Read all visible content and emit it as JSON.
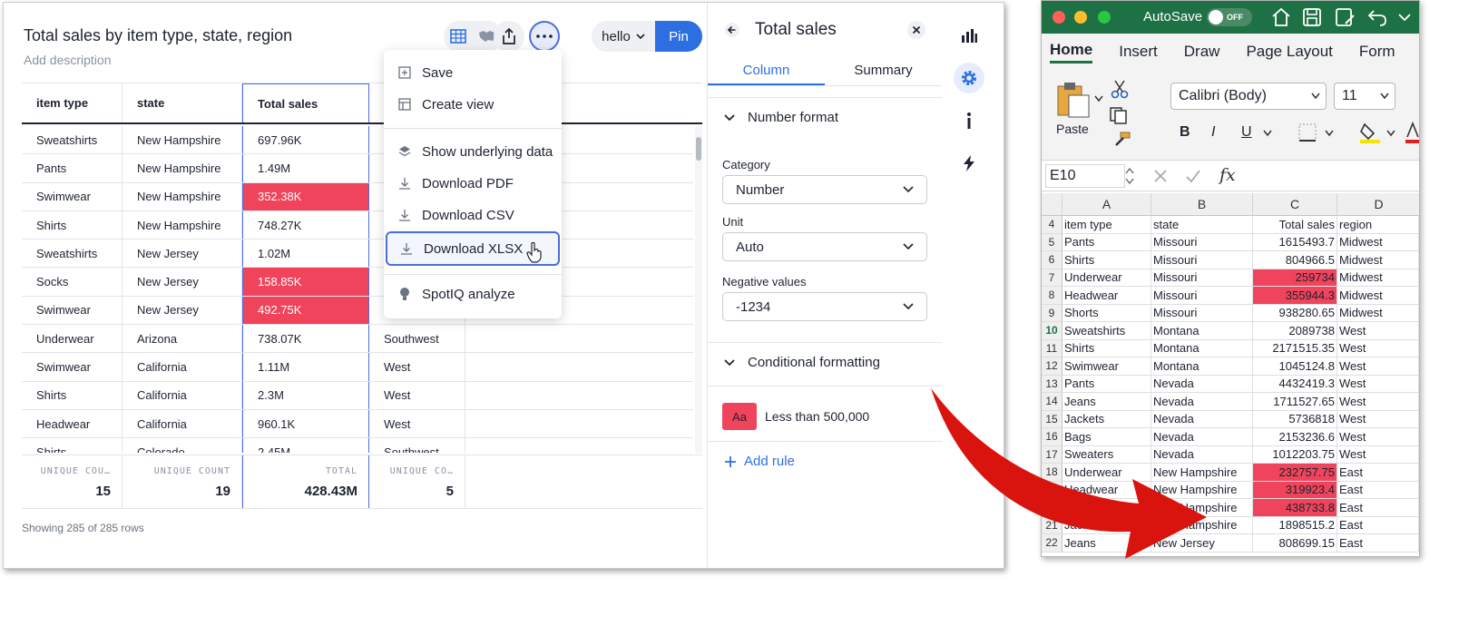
{
  "liveboard": {
    "title": "Total sales by item type, state, region",
    "description": "Add description",
    "hello_label": "hello",
    "pin_label": "Pin",
    "columns": [
      "item type",
      "state",
      "Total sales",
      "region"
    ],
    "rows": [
      {
        "item": "Sweatshirts",
        "state": "New Hampshire",
        "sales": "697.96K",
        "region": "",
        "hl": false
      },
      {
        "item": "Pants",
        "state": "New Hampshire",
        "sales": "1.49M",
        "region": "",
        "hl": false
      },
      {
        "item": "Swimwear",
        "state": "New Hampshire",
        "sales": "352.38K",
        "region": "",
        "hl": true
      },
      {
        "item": "Shirts",
        "state": "New Hampshire",
        "sales": "748.27K",
        "region": "",
        "hl": false
      },
      {
        "item": "Sweatshirts",
        "state": "New Jersey",
        "sales": "1.02M",
        "region": "",
        "hl": false
      },
      {
        "item": "Socks",
        "state": "New Jersey",
        "sales": "158.85K",
        "region": "",
        "hl": true
      },
      {
        "item": "Swimwear",
        "state": "New Jersey",
        "sales": "492.75K",
        "region": "",
        "hl": true
      },
      {
        "item": "Underwear",
        "state": "Arizona",
        "sales": "738.07K",
        "region": "Southwest",
        "hl": false
      },
      {
        "item": "Swimwear",
        "state": "California",
        "sales": "1.11M",
        "region": "West",
        "hl": false
      },
      {
        "item": "Shirts",
        "state": "California",
        "sales": "2.3M",
        "region": "West",
        "hl": false
      },
      {
        "item": "Headwear",
        "state": "California",
        "sales": "960.1K",
        "region": "West",
        "hl": false
      },
      {
        "item": "Shirts",
        "state": "Colorado",
        "sales": "2.45M",
        "region": "Southwest",
        "hl": false
      }
    ],
    "footer": [
      {
        "label": "UNIQUE COU…",
        "value": "15"
      },
      {
        "label": "UNIQUE COUNT",
        "value": "19"
      },
      {
        "label": "TOTAL",
        "value": "428.43M"
      },
      {
        "label": "UNIQUE CO…",
        "value": "5"
      }
    ],
    "row_count": "Showing 285 of 285 rows",
    "menu": {
      "save": "Save",
      "create_view": "Create view",
      "show_underlying": "Show underlying data",
      "download_pdf": "Download PDF",
      "download_csv": "Download CSV",
      "download_xlsx": "Download XLSX",
      "spotiq": "SpotIQ analyze"
    },
    "panel": {
      "title": "Total sales",
      "tab_column": "Column",
      "tab_summary": "Summary",
      "number_format": "Number format",
      "category_label": "Category",
      "category_value": "Number",
      "unit_label": "Unit",
      "unit_value": "Auto",
      "negative_label": "Negative values",
      "negative_value": "-1234",
      "conditional": "Conditional formatting",
      "rule_swatch": "Aa",
      "rule_text": "Less than 500,000",
      "add_rule": "Add rule"
    }
  },
  "excel": {
    "autosave": "AutoSave",
    "toggle_off": "OFF",
    "tabs": [
      "Home",
      "Insert",
      "Draw",
      "Page Layout",
      "Form"
    ],
    "font_name": "Calibri (Body)",
    "font_size": "11",
    "paste_label": "Paste",
    "bold": "B",
    "italic": "I",
    "underline": "U",
    "name_box": "E10",
    "fx": "fx",
    "col_headers": [
      "A",
      "B",
      "C",
      "D"
    ],
    "rows": [
      {
        "n": "4",
        "a": "item type",
        "b": "state",
        "c": "Total sales",
        "d": "region",
        "hl": false
      },
      {
        "n": "5",
        "a": "Pants",
        "b": "Missouri",
        "c": "1615493.7",
        "d": "Midwest",
        "hl": false
      },
      {
        "n": "6",
        "a": "Shirts",
        "b": "Missouri",
        "c": "804966.5",
        "d": "Midwest",
        "hl": false
      },
      {
        "n": "7",
        "a": "Underwear",
        "b": "Missouri",
        "c": "259734",
        "d": "Midwest",
        "hl": true
      },
      {
        "n": "8",
        "a": "Headwear",
        "b": "Missouri",
        "c": "355944.3",
        "d": "Midwest",
        "hl": true
      },
      {
        "n": "9",
        "a": "Shorts",
        "b": "Missouri",
        "c": "938280.65",
        "d": "Midwest",
        "hl": false
      },
      {
        "n": "10",
        "a": "Sweatshirts",
        "b": "Montana",
        "c": "2089738",
        "d": "West",
        "hl": false
      },
      {
        "n": "11",
        "a": "Shirts",
        "b": "Montana",
        "c": "2171515.35",
        "d": "West",
        "hl": false
      },
      {
        "n": "12",
        "a": "Swimwear",
        "b": "Montana",
        "c": "1045124.8",
        "d": "West",
        "hl": false
      },
      {
        "n": "13",
        "a": "Pants",
        "b": "Nevada",
        "c": "4432419.3",
        "d": "West",
        "hl": false
      },
      {
        "n": "14",
        "a": "Jeans",
        "b": "Nevada",
        "c": "1711527.65",
        "d": "West",
        "hl": false
      },
      {
        "n": "15",
        "a": "Jackets",
        "b": "Nevada",
        "c": "5736818",
        "d": "West",
        "hl": false
      },
      {
        "n": "16",
        "a": "Bags",
        "b": "Nevada",
        "c": "2153236.6",
        "d": "West",
        "hl": false
      },
      {
        "n": "17",
        "a": "Sweaters",
        "b": "Nevada",
        "c": "1012203.75",
        "d": "West",
        "hl": false
      },
      {
        "n": "18",
        "a": "Underwear",
        "b": "New Hampshire",
        "c": "232757.75",
        "d": "East",
        "hl": true
      },
      {
        "n": "19",
        "a": "Headwear",
        "b": "New Hampshire",
        "c": "319923.4",
        "d": "East",
        "hl": true
      },
      {
        "n": "20",
        "a": "Shirts",
        "b": "New Hampshire",
        "c": "438733.8",
        "d": "East",
        "hl": true
      },
      {
        "n": "21",
        "a": "Jackets",
        "b": "New Hampshire",
        "c": "1898515.2",
        "d": "East",
        "hl": false
      },
      {
        "n": "22",
        "a": "Jeans",
        "b": "New Jersey",
        "c": "808699.15",
        "d": "East",
        "hl": false
      }
    ]
  }
}
